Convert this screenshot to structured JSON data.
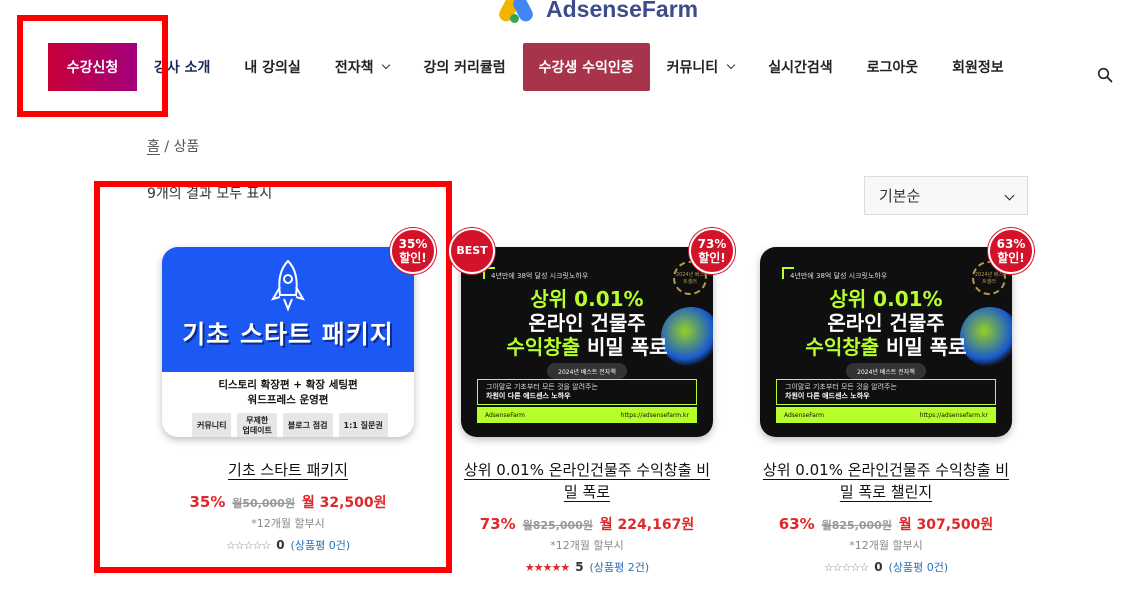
{
  "logo": {
    "text": "AdsenseFarm"
  },
  "nav": {
    "items": [
      {
        "label": "수강신청"
      },
      {
        "label": "강사 소개"
      },
      {
        "label": "내 강의실"
      },
      {
        "label": "전자책"
      },
      {
        "label": "강의 커리큘럼"
      },
      {
        "label": "수강생 수익인증"
      },
      {
        "label": "커뮤니티"
      },
      {
        "label": "실시간검색"
      },
      {
        "label": "로그아웃"
      },
      {
        "label": "회원정보"
      }
    ],
    "search_icon": "search-icon"
  },
  "breadcrumb": {
    "home": "홈",
    "separator": "/",
    "current": "상품"
  },
  "result_count": "9개의 결과 모두 표시",
  "sort": {
    "selected": "기본순"
  },
  "products": [
    {
      "badge": "35%\n할인!",
      "thumb": {
        "title": "기초 스타트 패키지",
        "sub1": "티스토리 확장편 + 확장 세팅편",
        "sub2": "워드프레스 운영편",
        "chips": [
          "커뮤니티",
          "무제한\n업데이트",
          "블로그 점검",
          "1:1 질문권"
        ]
      },
      "title": "기초 스타트 패키지",
      "price": {
        "percent": "35%",
        "old": "월50,000원",
        "new": "월 32,500원"
      },
      "note": "*12개월 할부시",
      "rating": {
        "stars": "☆☆☆☆☆",
        "count": "0",
        "reviews": "(상품평 0건)"
      }
    },
    {
      "badge": "BEST",
      "badge2": "73%\n할인!",
      "thumb": {
        "top": "4년만에 38억 달성 시크릿노하우",
        "seal": "2024년 베스트셀러",
        "line1": "상위 0.01%",
        "line2": "온라인 건물주",
        "line3a": "수익창출",
        "line3b": " 비밀 폭로",
        "pill": "2024년 베스트 전자책",
        "box1": "그이말로 기초부터 모든 것을 알려주는",
        "box2": "차원이 다른 애드센스 노하우",
        "foot_left": "AdsenseFarm",
        "foot_right": "https://adsensefarm.kr"
      },
      "title": "상위 0.01% 온라인건물주 수익창출 비밀 폭로",
      "price": {
        "percent": "73%",
        "old": "월825,000원",
        "new": "월 224,167원"
      },
      "note": "*12개월 할부시",
      "rating": {
        "stars": "★★★★★",
        "count": "5",
        "reviews": "(상품평 2건)"
      }
    },
    {
      "badge": "63%\n할인!",
      "thumb": {
        "top": "4년만에 38억 달성 시크릿노하우",
        "seal": "2024년 베스트셀러",
        "line1": "상위 0.01%",
        "line2": "온라인 건물주",
        "line3a": "수익창출",
        "line3b": " 비밀 폭로",
        "pill": "2024년 베스트 전자책",
        "box1": "그이말로 기초부터 모든 것을 알려주는",
        "box2": "차원이 다른 애드센스 노하우",
        "foot_left": "AdsenseFarm",
        "foot_right": "https://adsensefarm.kr"
      },
      "title": "상위 0.01% 온라인건물주 수익창출 비밀 폭로 챌린지",
      "price": {
        "percent": "63%",
        "old": "월825,000원",
        "new": "월 307,500원"
      },
      "note": "*12개월 할부시",
      "rating": {
        "stars": "☆☆☆☆☆",
        "count": "0",
        "reviews": "(상품평 0건)"
      }
    }
  ]
}
